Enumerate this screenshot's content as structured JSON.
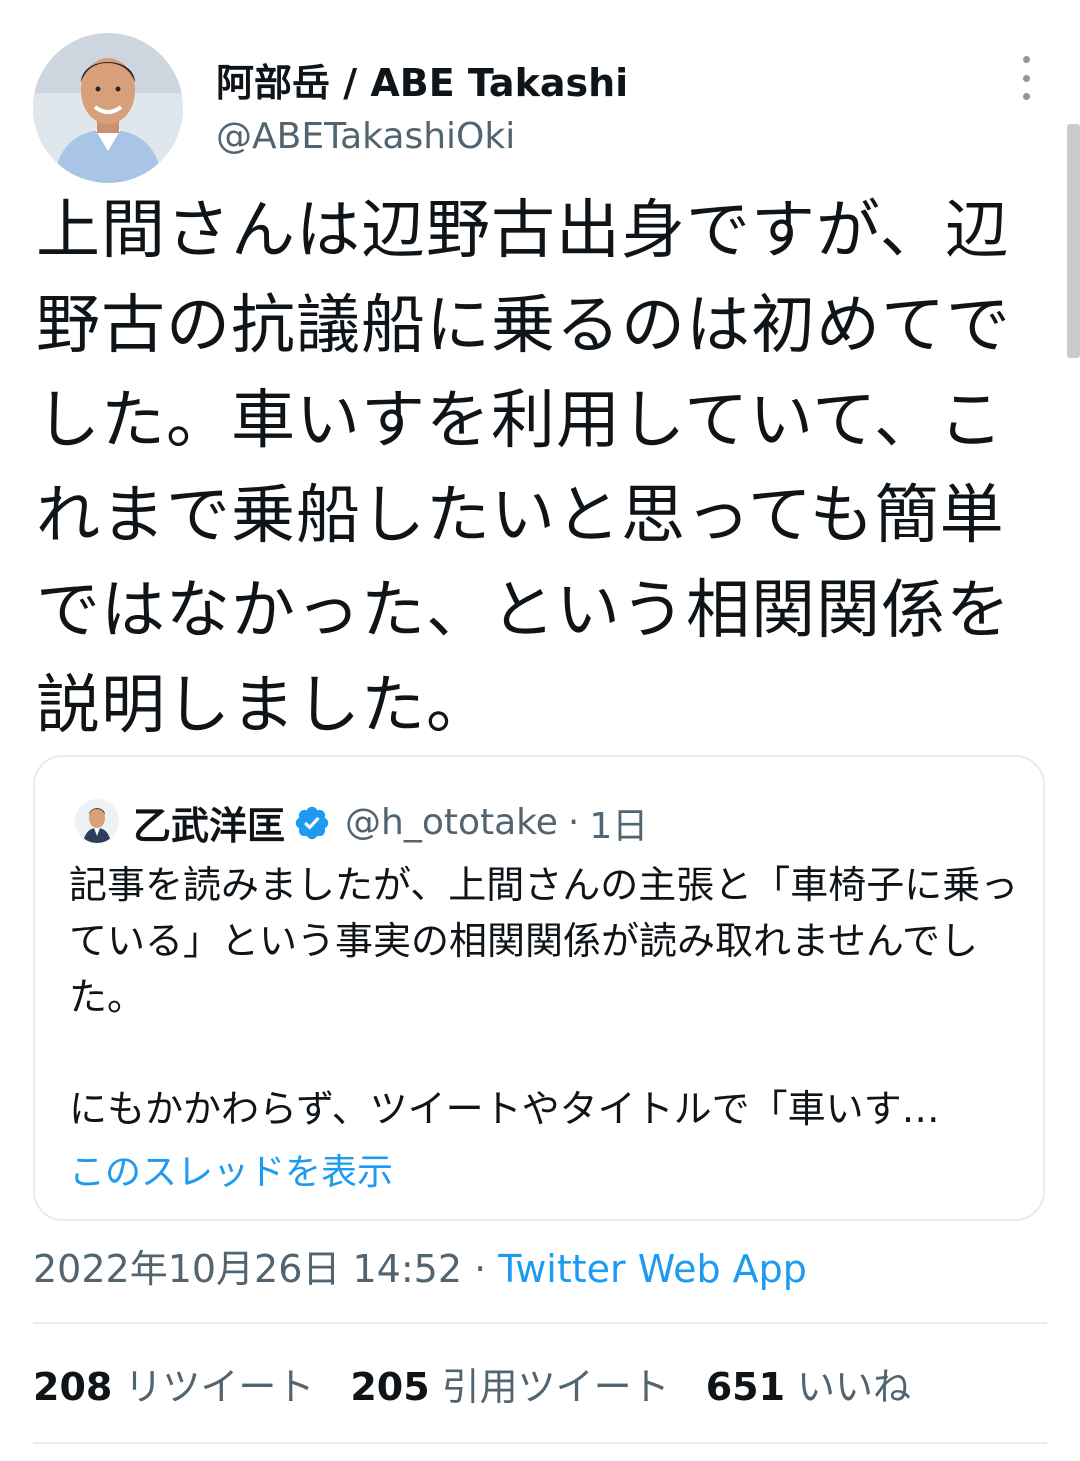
{
  "tweet": {
    "author_name": "阿部岳 / ABE Takashi",
    "author_handle": "@ABETakashiOki",
    "more_icon": "more-vertical-icon",
    "text": "上間さんは辺野古出身ですが、辺野古の抗議船に乗るのは初めてでした。車いすを利用していて、これまで乗船したいと思っても簡単ではなかった、という相関関係を説明しました。",
    "timestamp": "2022年10月26日 14:52",
    "separator": "·",
    "source": "Twitter Web App"
  },
  "quoted": {
    "name": "乙武洋匡",
    "verified_icon": "verified-badge-icon",
    "handle": "@h_ototake",
    "separator": "·",
    "time": "1日",
    "paragraph1": "記事を読みましたが、上間さんの主張と「車椅子に乗っている」という事実の相関関係が読み取れませんでした。",
    "paragraph2": "にもかかわらず、ツイートやタイトルで「車いす…",
    "show_thread": "このスレッドを表示"
  },
  "stats": {
    "retweets_count": "208",
    "retweets_label": "リツイート",
    "quotes_count": "205",
    "quotes_label": "引用ツイート",
    "likes_count": "651",
    "likes_label": "いいね"
  },
  "colors": {
    "text": "#0f1419",
    "secondary": "#536471",
    "accent": "#1d9bf0",
    "border": "#e6ecf0"
  }
}
